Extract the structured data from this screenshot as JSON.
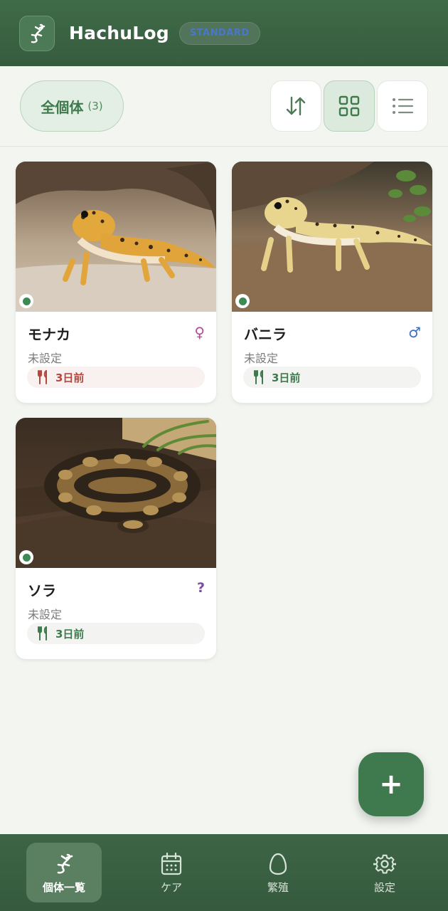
{
  "header": {
    "app_title": "HachuLog",
    "plan_badge": "STANDARD"
  },
  "filter": {
    "all_label": "全個体",
    "all_count": "(3)",
    "view_mode": "grid"
  },
  "animals": [
    {
      "name": "モナカ",
      "sex": "female",
      "sex_symbol": "♀",
      "morph": "未設定",
      "last_fed": "3日前",
      "fed_status": "warning",
      "species_icon": "leopard-gecko"
    },
    {
      "name": "バニラ",
      "sex": "male",
      "sex_symbol": "♂",
      "morph": "未設定",
      "last_fed": "3日前",
      "fed_status": "ok",
      "species_icon": "leopard-gecko"
    },
    {
      "name": "ソラ",
      "sex": "unknown",
      "sex_symbol": "?",
      "morph": "未設定",
      "last_fed": "3日前",
      "fed_status": "ok",
      "species_icon": "ball-python"
    }
  ],
  "fab": {
    "symbol": "+"
  },
  "nav": {
    "items": [
      {
        "label": "個体一覧",
        "icon": "gecko-icon",
        "active": true
      },
      {
        "label": "ケア",
        "icon": "calendar-icon",
        "active": false
      },
      {
        "label": "繁殖",
        "icon": "egg-icon",
        "active": false
      },
      {
        "label": "設定",
        "icon": "gear-icon",
        "active": false
      }
    ]
  },
  "colors": {
    "brand_green": "#3f6b48",
    "accent_green": "#3e7a4d",
    "female": "#b44d93",
    "male": "#3d6fbf",
    "unknown": "#7b4ea5",
    "warn": "#b5483e"
  }
}
